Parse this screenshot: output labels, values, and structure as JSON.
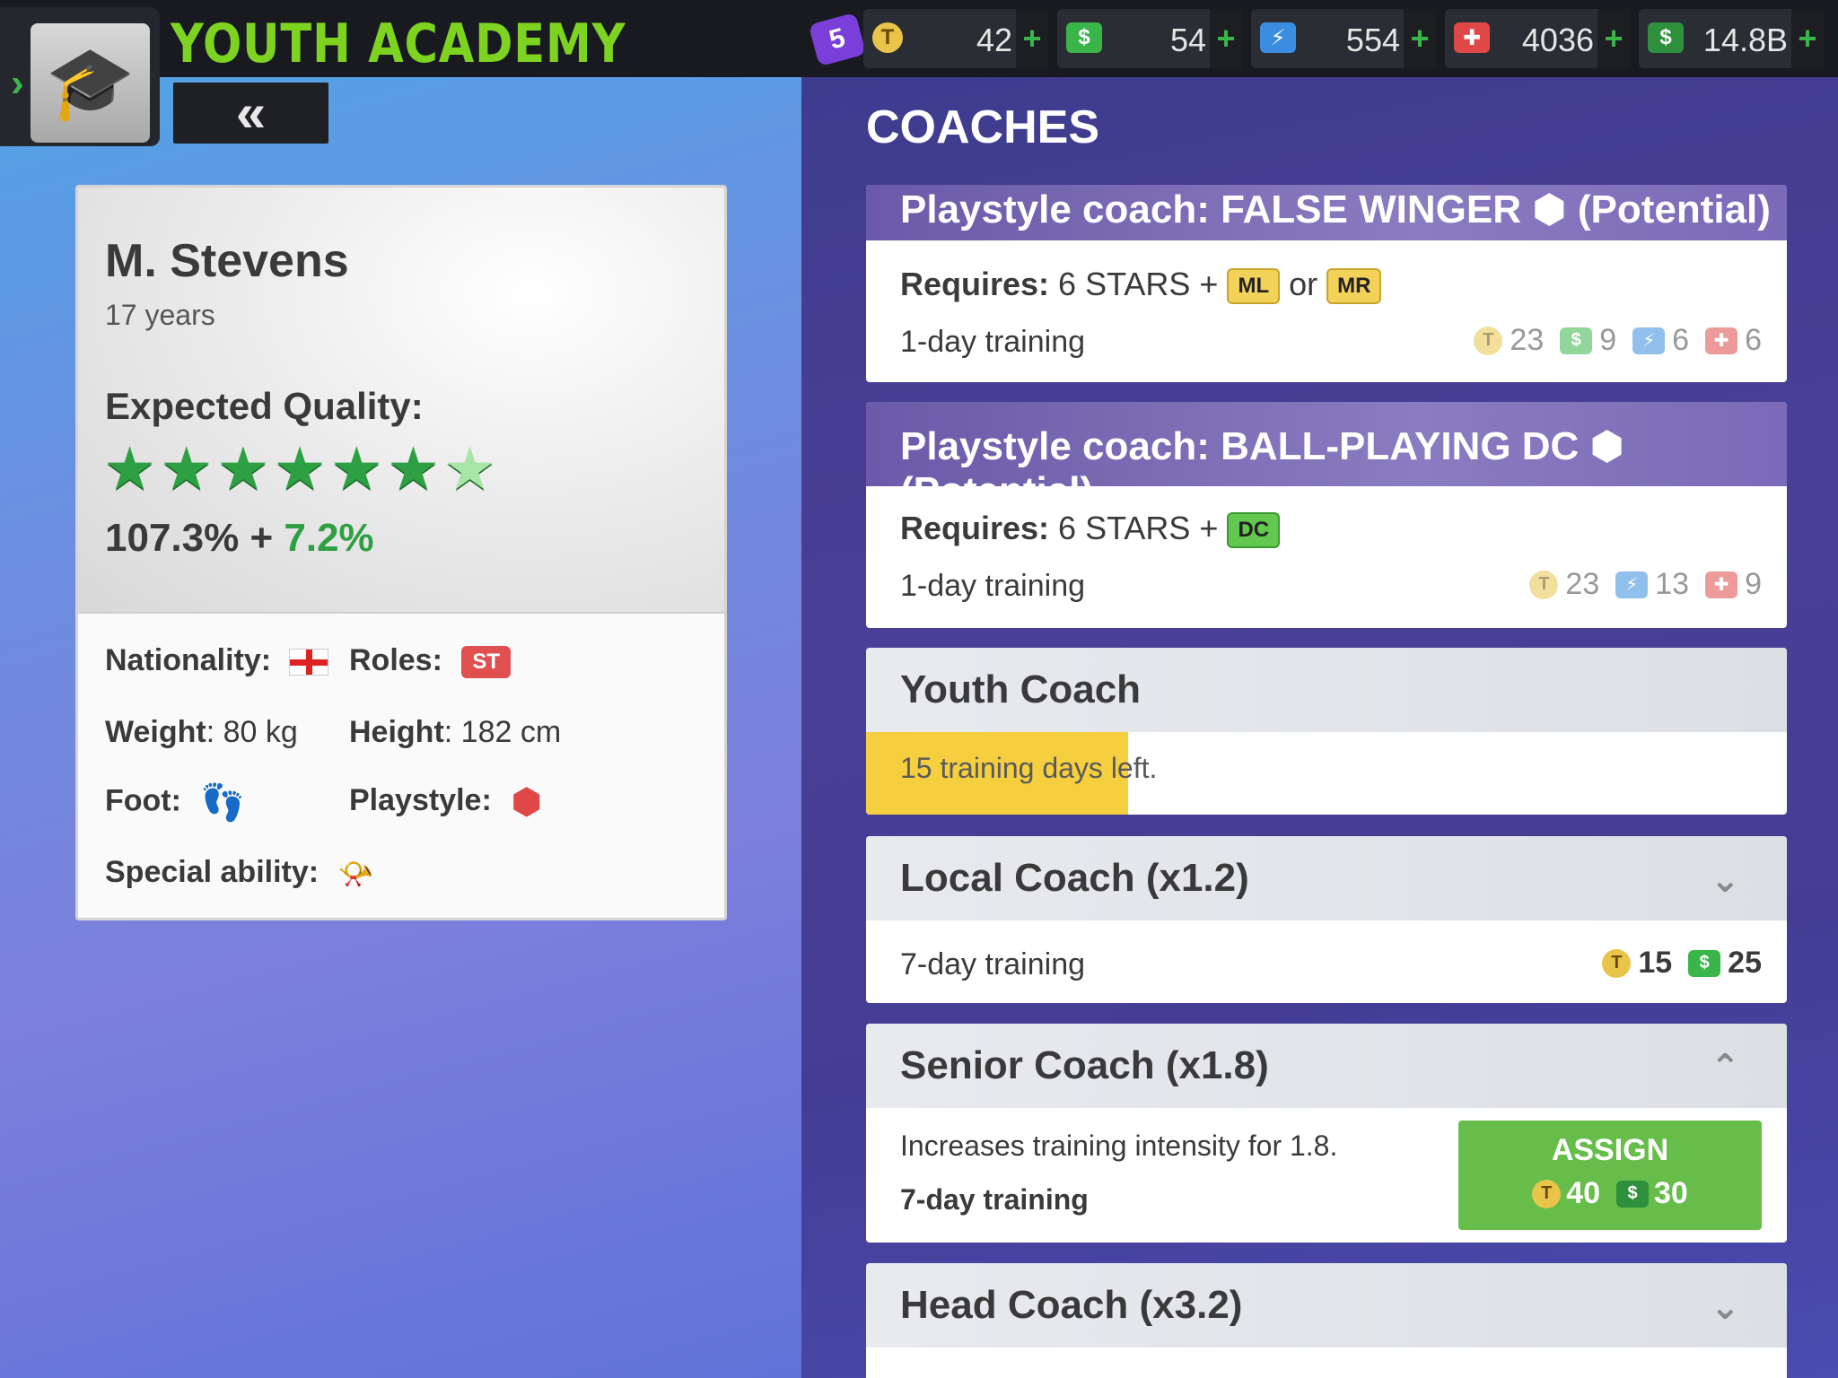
{
  "header": {
    "title": "YOUTH ACADEMY",
    "back_label": "«",
    "notification_count": "5",
    "currencies": [
      {
        "icon": "coin-icon",
        "value": "42",
        "plus": "+",
        "color": "#e8c54a"
      },
      {
        "icon": "cash-icon",
        "value": "54",
        "plus": "+",
        "color": "#3ab54a"
      },
      {
        "icon": "energy-icon",
        "value": "554",
        "plus": "+",
        "color": "#3a8de0"
      },
      {
        "icon": "medical-icon",
        "value": "4036",
        "plus": "+",
        "color": "#e04848"
      },
      {
        "icon": "money-icon",
        "value": "14.8B",
        "plus": "+",
        "color": "#3ab54a"
      }
    ]
  },
  "player": {
    "name": "M. Stevens",
    "age": "17 years",
    "expected_quality_label": "Expected Quality:",
    "stars": 6.5,
    "quality": "107.3% +",
    "quality_bonus": "7.2%",
    "nationality_label": "Nationality:",
    "roles_label": "Roles:",
    "role": "ST",
    "weight_label": "Weight",
    "weight_value": ": 80 kg",
    "height_label": "Height",
    "height_value": ": 182 cm",
    "foot_label": "Foot:",
    "playstyle_label": "Playstyle:",
    "special_label": "Special ability:"
  },
  "coaches": {
    "title": "COACHES",
    "items": [
      {
        "title": "Playstyle coach: FALSE WINGER ⬢ (Potential)",
        "requires_label": "Requires:",
        "requires_text": " 6 STARS + ",
        "tags": [
          "ML",
          "MR"
        ],
        "or": " or ",
        "training": "1-day training",
        "costs": [
          "23",
          "9",
          "6",
          "6"
        ]
      },
      {
        "title": "Playstyle coach: BALL-PLAYING DC ⬢ (Potential)",
        "requires_label": "Requires:",
        "requires_text": " 6 STARS + ",
        "tags": [
          "DC"
        ],
        "training": "1-day training",
        "costs": [
          "23",
          "13",
          "9"
        ]
      },
      {
        "title": "Youth Coach",
        "progress_text": "15 training days left.",
        "progress_fraction": 0.285
      },
      {
        "title": "Local Coach (x1.2)",
        "training": "7-day training",
        "costs": [
          "15",
          "25"
        ]
      },
      {
        "title": "Senior Coach (x1.8)",
        "description": "Increases training intensity for 1.8.",
        "training": "7-day training",
        "assign_label": "ASSIGN",
        "assign_costs": [
          "40",
          "30"
        ]
      },
      {
        "title": "Head Coach (x3.2)"
      }
    ]
  }
}
